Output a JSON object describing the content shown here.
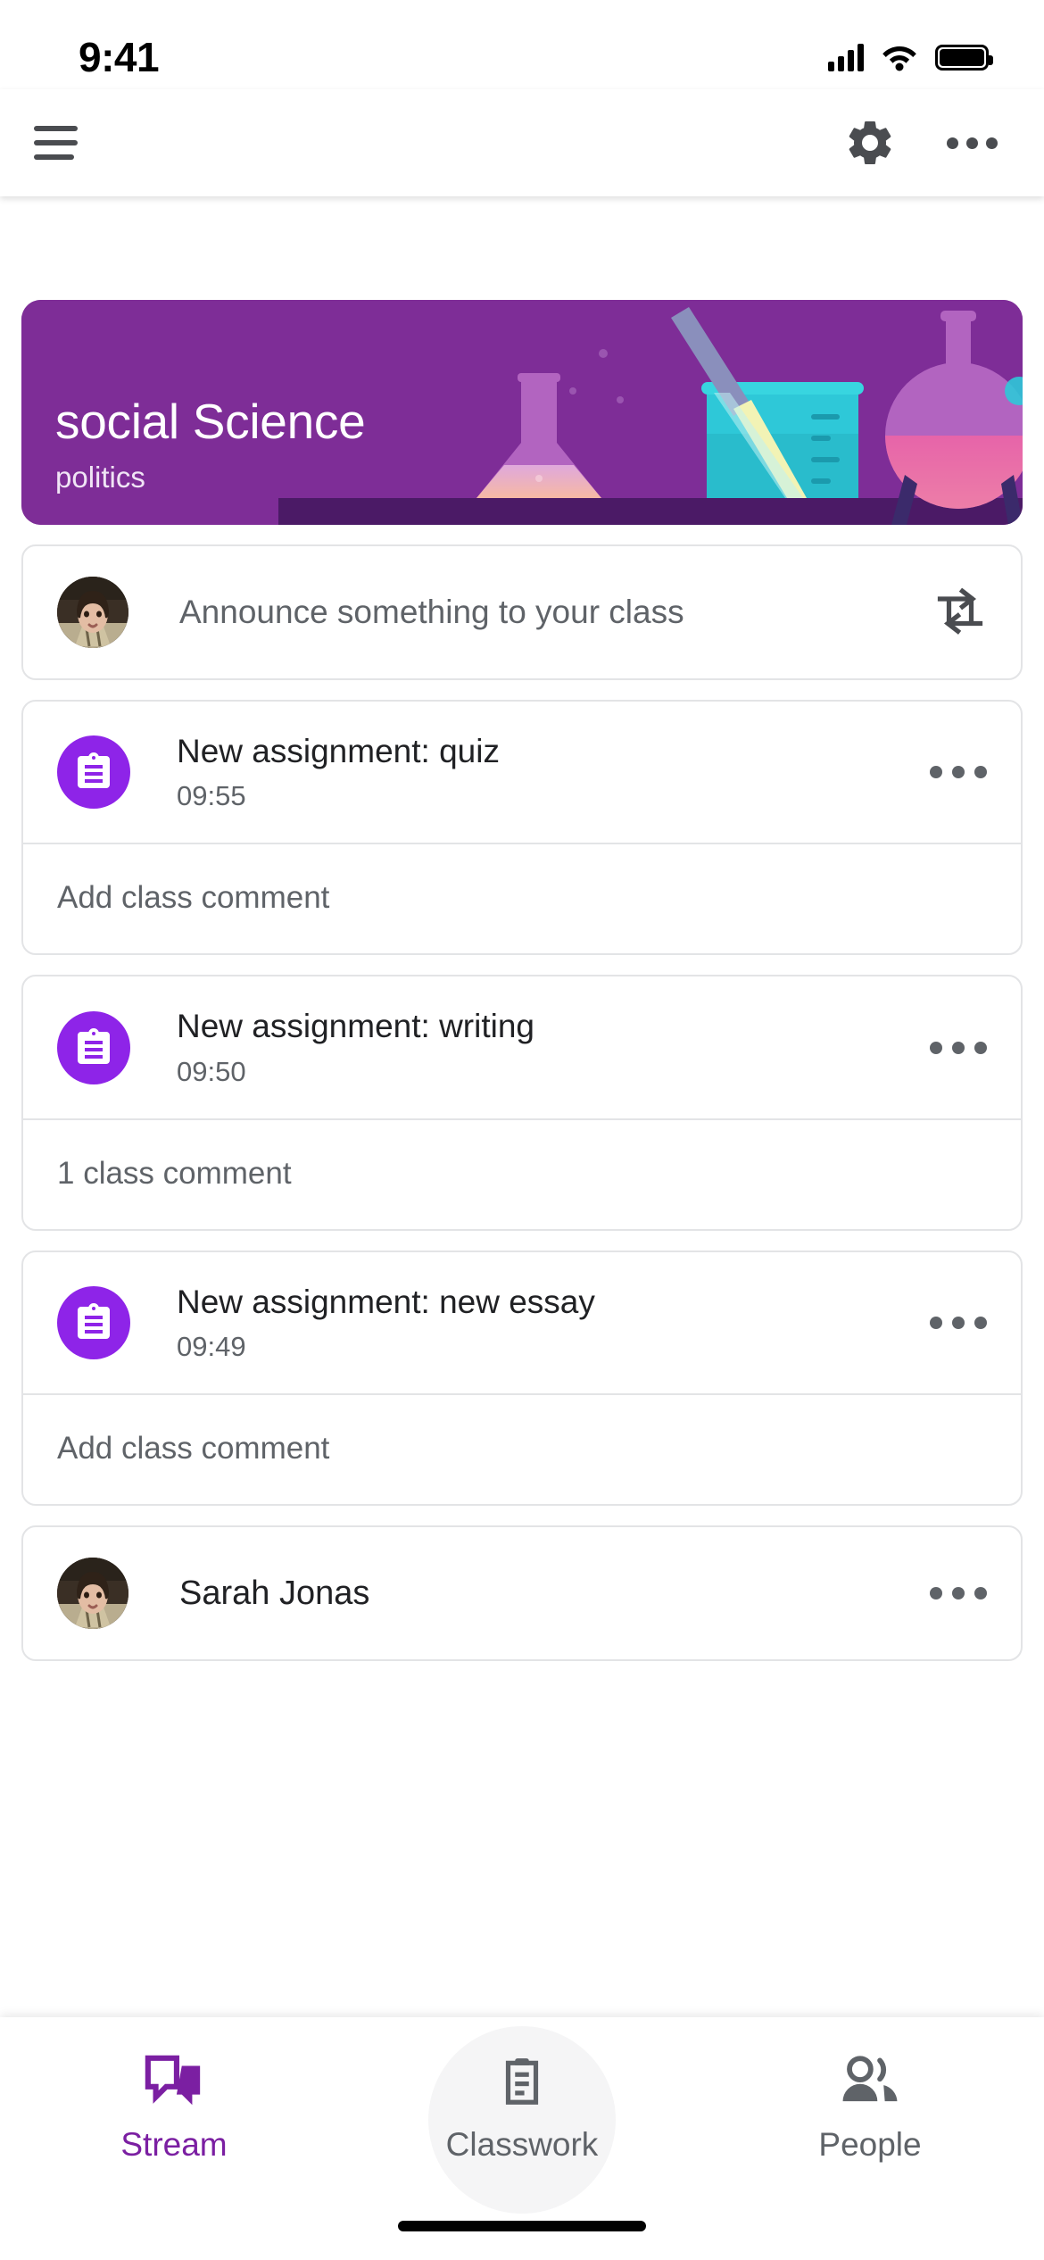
{
  "status_bar": {
    "time": "9:41",
    "signal_icon": "cellular-signal-icon",
    "wifi_icon": "wifi-icon",
    "battery_icon": "battery-full-icon"
  },
  "app_bar": {
    "menu_icon": "hamburger-menu-icon",
    "settings_icon": "gear-icon",
    "overflow_icon": "more-options-icon"
  },
  "banner": {
    "title": "social Science",
    "subtitle": "politics",
    "background_color": "#7e2d97",
    "illustration": "science-lab-beakers-illustration"
  },
  "announce_card": {
    "avatar": "user-avatar-photo",
    "placeholder": "Announce something to your class",
    "action_icon": "swap-arrows-icon"
  },
  "stream_items": [
    {
      "icon": "assignment-clipboard-icon",
      "icon_color": "#8e24e8",
      "title": "New assignment: quiz",
      "time": "09:55",
      "overflow_icon": "more-options-icon",
      "comment_text": "Add class comment"
    },
    {
      "icon": "assignment-clipboard-icon",
      "icon_color": "#8e24e8",
      "title": "New assignment: writing",
      "time": "09:50",
      "overflow_icon": "more-options-icon",
      "comment_text": "1 class comment"
    },
    {
      "icon": "assignment-clipboard-icon",
      "icon_color": "#8e24e8",
      "title": "New assignment: new essay",
      "time": "09:49",
      "overflow_icon": "more-options-icon",
      "comment_text": "Add class comment"
    }
  ],
  "person_post": {
    "avatar": "user-avatar-photo",
    "name": "Sarah Jonas",
    "overflow_icon": "more-options-icon"
  },
  "bottom_nav": {
    "active_color": "#7b1fa2",
    "inactive_color": "#5f6368",
    "tabs": [
      {
        "label": "Stream",
        "icon": "stream-chat-icon",
        "active": true
      },
      {
        "label": "Classwork",
        "icon": "classwork-clipboard-icon",
        "active": false
      },
      {
        "label": "People",
        "icon": "people-icon",
        "active": false
      }
    ]
  }
}
